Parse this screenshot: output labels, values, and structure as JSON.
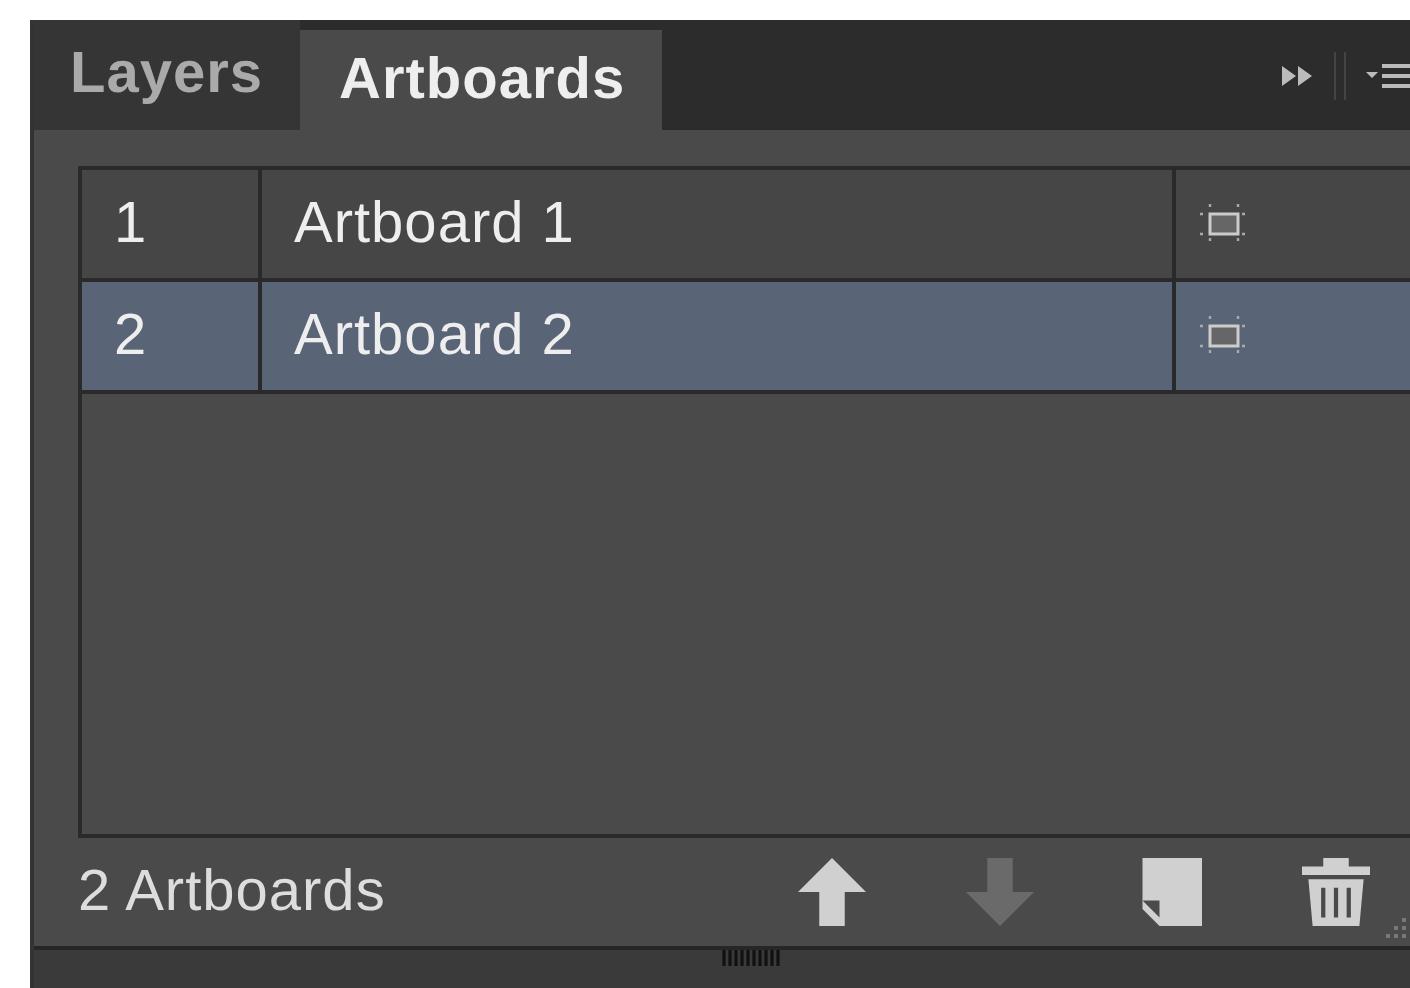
{
  "tabs": [
    {
      "label": "Layers",
      "selected": false
    },
    {
      "label": "Artboards",
      "selected": true
    }
  ],
  "rows": [
    {
      "number": "1",
      "name": "Artboard 1",
      "selected": false
    },
    {
      "number": "2",
      "name": "Artboard 2",
      "selected": true
    }
  ],
  "footer": {
    "count": "2 Artboards",
    "buttons": [
      {
        "kind": "up",
        "disabled": false
      },
      {
        "kind": "down",
        "disabled": true
      },
      {
        "kind": "new",
        "disabled": false
      },
      {
        "kind": "delete",
        "disabled": false
      }
    ]
  }
}
